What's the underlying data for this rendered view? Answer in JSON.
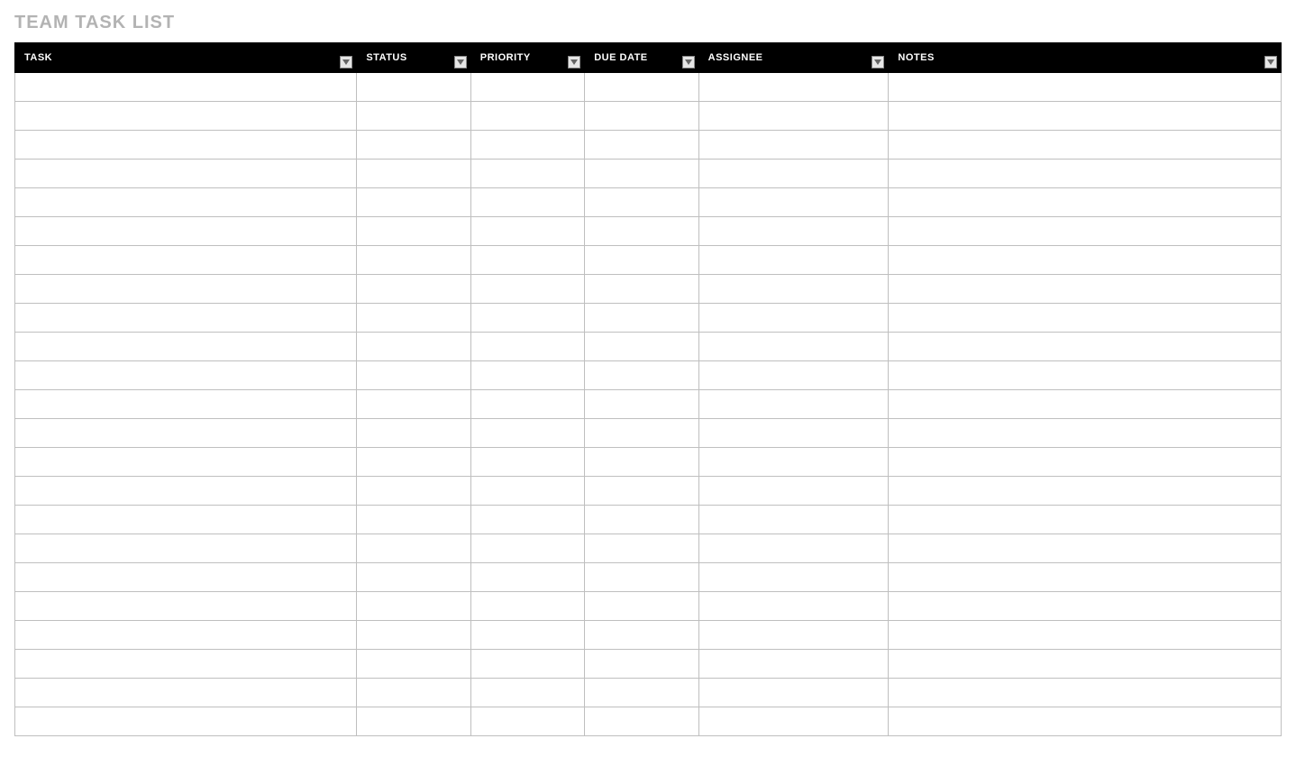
{
  "title": "TEAM TASK LIST",
  "columns": [
    {
      "label": "TASK"
    },
    {
      "label": "STATUS"
    },
    {
      "label": "PRIORITY"
    },
    {
      "label": "DUE DATE"
    },
    {
      "label": "ASSIGNEE"
    },
    {
      "label": "NOTES"
    }
  ],
  "rows": [
    {
      "task": "",
      "status": "",
      "priority": "",
      "due_date": "",
      "assignee": "",
      "notes": ""
    },
    {
      "task": "",
      "status": "",
      "priority": "",
      "due_date": "",
      "assignee": "",
      "notes": ""
    },
    {
      "task": "",
      "status": "",
      "priority": "",
      "due_date": "",
      "assignee": "",
      "notes": ""
    },
    {
      "task": "",
      "status": "",
      "priority": "",
      "due_date": "",
      "assignee": "",
      "notes": ""
    },
    {
      "task": "",
      "status": "",
      "priority": "",
      "due_date": "",
      "assignee": "",
      "notes": ""
    },
    {
      "task": "",
      "status": "",
      "priority": "",
      "due_date": "",
      "assignee": "",
      "notes": ""
    },
    {
      "task": "",
      "status": "",
      "priority": "",
      "due_date": "",
      "assignee": "",
      "notes": ""
    },
    {
      "task": "",
      "status": "",
      "priority": "",
      "due_date": "",
      "assignee": "",
      "notes": ""
    },
    {
      "task": "",
      "status": "",
      "priority": "",
      "due_date": "",
      "assignee": "",
      "notes": ""
    },
    {
      "task": "",
      "status": "",
      "priority": "",
      "due_date": "",
      "assignee": "",
      "notes": ""
    },
    {
      "task": "",
      "status": "",
      "priority": "",
      "due_date": "",
      "assignee": "",
      "notes": ""
    },
    {
      "task": "",
      "status": "",
      "priority": "",
      "due_date": "",
      "assignee": "",
      "notes": ""
    },
    {
      "task": "",
      "status": "",
      "priority": "",
      "due_date": "",
      "assignee": "",
      "notes": ""
    },
    {
      "task": "",
      "status": "",
      "priority": "",
      "due_date": "",
      "assignee": "",
      "notes": ""
    },
    {
      "task": "",
      "status": "",
      "priority": "",
      "due_date": "",
      "assignee": "",
      "notes": ""
    },
    {
      "task": "",
      "status": "",
      "priority": "",
      "due_date": "",
      "assignee": "",
      "notes": ""
    },
    {
      "task": "",
      "status": "",
      "priority": "",
      "due_date": "",
      "assignee": "",
      "notes": ""
    },
    {
      "task": "",
      "status": "",
      "priority": "",
      "due_date": "",
      "assignee": "",
      "notes": ""
    },
    {
      "task": "",
      "status": "",
      "priority": "",
      "due_date": "",
      "assignee": "",
      "notes": ""
    },
    {
      "task": "",
      "status": "",
      "priority": "",
      "due_date": "",
      "assignee": "",
      "notes": ""
    },
    {
      "task": "",
      "status": "",
      "priority": "",
      "due_date": "",
      "assignee": "",
      "notes": ""
    },
    {
      "task": "",
      "status": "",
      "priority": "",
      "due_date": "",
      "assignee": "",
      "notes": ""
    },
    {
      "task": "",
      "status": "",
      "priority": "",
      "due_date": "",
      "assignee": "",
      "notes": ""
    }
  ]
}
